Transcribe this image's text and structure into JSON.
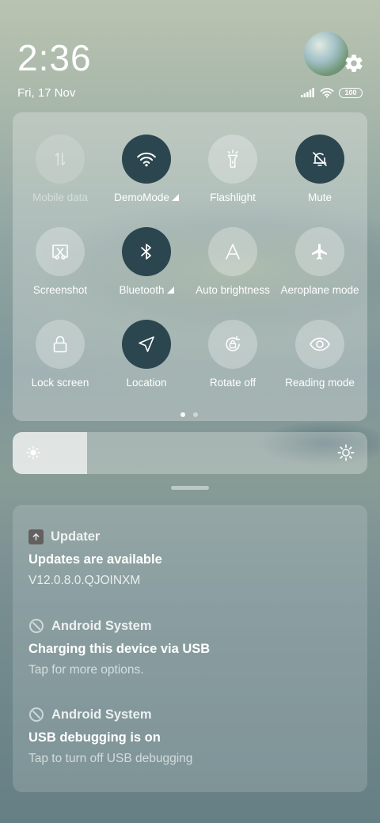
{
  "status": {
    "time": "2:36",
    "date": "Fri, 17 Nov",
    "battery": "100"
  },
  "quick_settings": {
    "tiles": [
      {
        "label": "Mobile data",
        "icon": "mobile-data-icon",
        "state": "unavailable"
      },
      {
        "label": "DemoMode",
        "icon": "wifi-icon",
        "state": "on",
        "expand": true
      },
      {
        "label": "Flashlight",
        "icon": "flashlight-icon",
        "state": "off"
      },
      {
        "label": "Mute",
        "icon": "mute-bell-icon",
        "state": "on"
      },
      {
        "label": "Screenshot",
        "icon": "screenshot-icon",
        "state": "off"
      },
      {
        "label": "Bluetooth",
        "icon": "bluetooth-icon",
        "state": "on",
        "expand": true
      },
      {
        "label": "Auto brightness",
        "icon": "auto-brightness-icon",
        "state": "off"
      },
      {
        "label": "Aeroplane mode",
        "icon": "airplane-icon",
        "state": "off"
      },
      {
        "label": "Lock screen",
        "icon": "lock-icon",
        "state": "off"
      },
      {
        "label": "Location",
        "icon": "location-icon",
        "state": "on"
      },
      {
        "label": "Rotate off",
        "icon": "rotate-lock-icon",
        "state": "off"
      },
      {
        "label": "Reading mode",
        "icon": "eye-icon",
        "state": "off"
      }
    ],
    "page_count": 2,
    "current_page": 1
  },
  "brightness": {
    "level": 0.21
  },
  "notifications": [
    {
      "app": "Updater",
      "icon": "updater-icon",
      "title": "Updates are available",
      "text": "V12.0.8.0.QJOINXM"
    },
    {
      "app": "Android System",
      "icon": "android-system-icon",
      "title": "Charging this device via USB",
      "text": "Tap for more options."
    },
    {
      "app": "Android System",
      "icon": "android-system-icon",
      "title": "USB debugging is on",
      "text": "Tap to turn off USB debugging"
    }
  ],
  "colors": {
    "tile_on": "#2c4650",
    "panel": "rgba(235,240,236,0.32)"
  }
}
